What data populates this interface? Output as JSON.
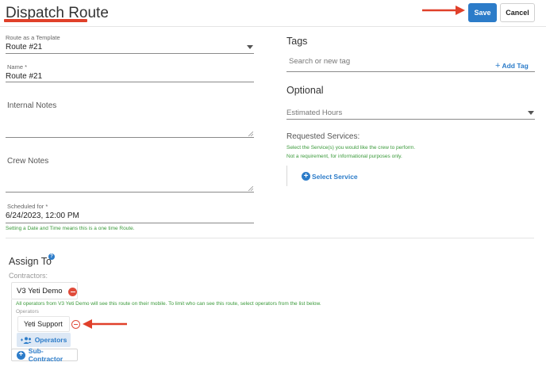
{
  "header": {
    "title": "Dispatch Route",
    "save_label": "Save",
    "cancel_label": "Cancel"
  },
  "left": {
    "template": {
      "label": "Route as a Template",
      "value": "Route #21"
    },
    "name": {
      "label": "Name *",
      "value": "Route #21"
    },
    "internal_notes": {
      "label": "Internal Notes"
    },
    "crew_notes": {
      "label": "Crew Notes"
    },
    "scheduled": {
      "label": "Scheduled for *",
      "value": "6/24/2023, 12:00 PM",
      "hint": "Setting a Date and Time means this is a one time Route."
    }
  },
  "right": {
    "tags": {
      "heading": "Tags",
      "placeholder": "Search or new tag",
      "add_label": "Add Tag"
    },
    "optional": {
      "heading": "Optional",
      "estimated_hours": "Estimated Hours",
      "requested_services_label": "Requested Services:",
      "services_hint_1": "Select the Service(s) you would like the crew to perform.",
      "services_hint_2": "Not a requirement, for informational purposes only.",
      "select_service_label": "Select Service"
    }
  },
  "assign": {
    "heading": "Assign To",
    "info_icon": "?",
    "contractors_label": "Contractors:",
    "contractor_name": "V3 Yeti Demo",
    "contractor_hint": "All operators from V3 Yeti Demo will see this route on their mobile. To limit who can see this route, select operators from the list below.",
    "operators_label": "Operators",
    "operator_name": "Yeti Support",
    "operators_button": "Operators",
    "subcontractor_button": "Sub-Contractor"
  },
  "colors": {
    "primary": "#2c7cc9",
    "danger": "#e04b3a",
    "hint_green": "#3b9a3b",
    "annotation_red": "#e0402a"
  },
  "icons": {
    "dropdown": "caret-down-icon",
    "add_tag": "plus-icon",
    "select_service": "plus-circle-icon",
    "remove": "minus-circle-icon",
    "operators": "users-plus-icon",
    "subcontractor": "plus-circle-icon",
    "info": "info-icon",
    "annotation": "arrow-icon"
  }
}
